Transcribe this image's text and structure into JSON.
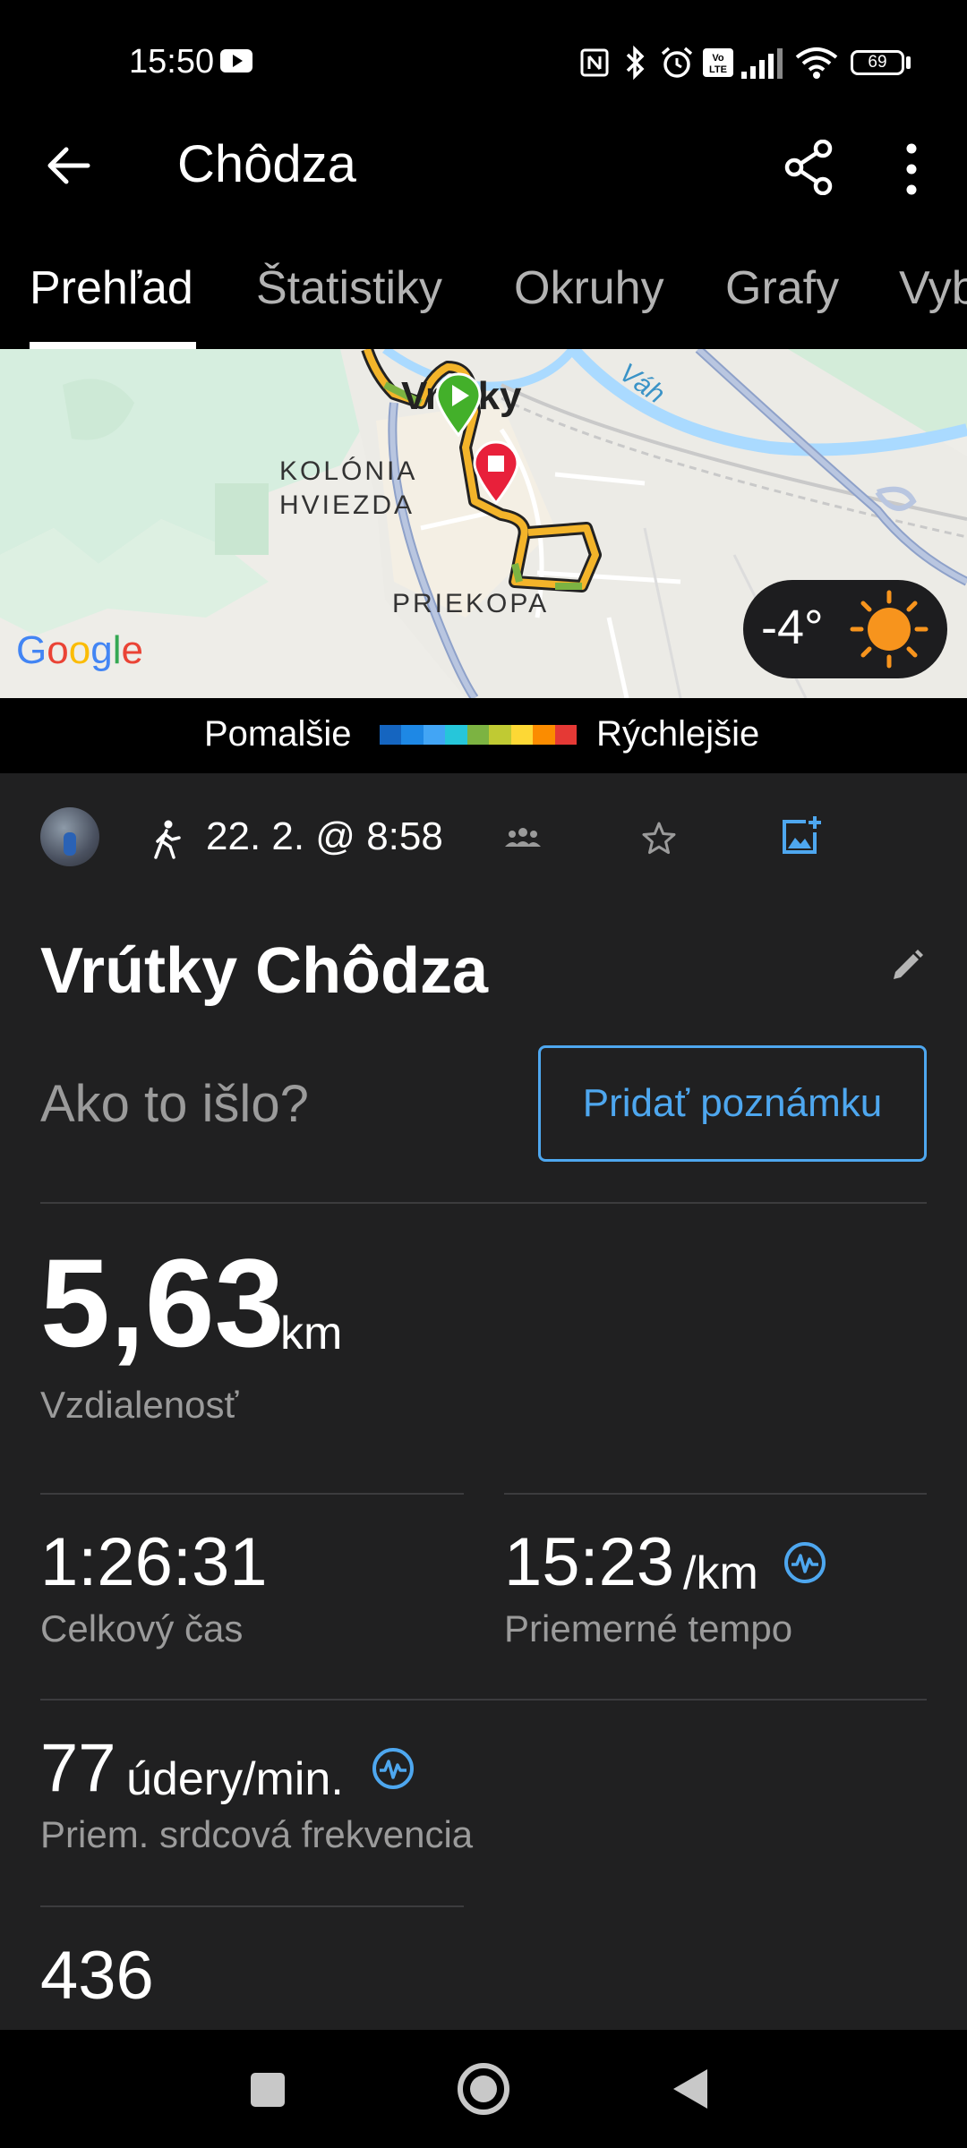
{
  "status_bar": {
    "time": "15:50",
    "battery": "69",
    "icons": [
      "youtube-icon",
      "nfc-icon",
      "bluetooth-icon",
      "alarm-icon",
      "volte-icon",
      "signal-icon",
      "wifi-icon",
      "battery-icon"
    ]
  },
  "app_bar": {
    "title": "Chôdza",
    "icons": [
      "back-arrow-icon",
      "share-icon",
      "more-vert-icon"
    ]
  },
  "tabs": [
    {
      "label": "Prehľad",
      "active": true
    },
    {
      "label": "Štatistiky",
      "active": false
    },
    {
      "label": "Okruhy",
      "active": false
    },
    {
      "label": "Grafy",
      "active": false
    },
    {
      "label": "Vyb",
      "active": false
    }
  ],
  "map": {
    "labels": {
      "town": "Vrútky",
      "river": "Váh",
      "district1_line1": "KOLÓNIA",
      "district1_line2": "HVIEZDA",
      "district2": "PRIEKOPA",
      "google": "Google"
    },
    "weather": {
      "temp": "-4°",
      "icon": "sun-icon"
    }
  },
  "speed_legend": {
    "slower": "Pomalšie",
    "faster": "Rýchlejšie",
    "colors": [
      "#1565c0",
      "#1e88e5",
      "#42a5f5",
      "#26c6da",
      "#7cb342",
      "#c0ca33",
      "#fdd835",
      "#fb8c00",
      "#e53935"
    ]
  },
  "activity_meta": {
    "date": "22. 2. @ 8:58",
    "icons": [
      "avatar",
      "walk-icon",
      "group-icon",
      "star-icon",
      "add-photo-icon"
    ]
  },
  "activity": {
    "title": "Vrútky Chôdza",
    "note_prompt": "Ako to išlo?",
    "add_note_button": "Pridať poznámku"
  },
  "stats": {
    "distance": {
      "value": "5,63",
      "unit": "km",
      "label": "Vzdialenosť"
    },
    "total_time": {
      "value": "1:26:31",
      "label": "Celkový čas"
    },
    "avg_pace": {
      "value": "15:23",
      "unit": "/km",
      "label": "Priemerné tempo"
    },
    "avg_hr": {
      "value": "77",
      "unit": "údery/min.",
      "label": "Priem. srdcová frekvencia"
    },
    "steps": {
      "value": "436"
    }
  },
  "colors": {
    "accent": "#4ea7ef",
    "background": "#202021",
    "start": "#43b02a",
    "stop": "#e8203a"
  }
}
